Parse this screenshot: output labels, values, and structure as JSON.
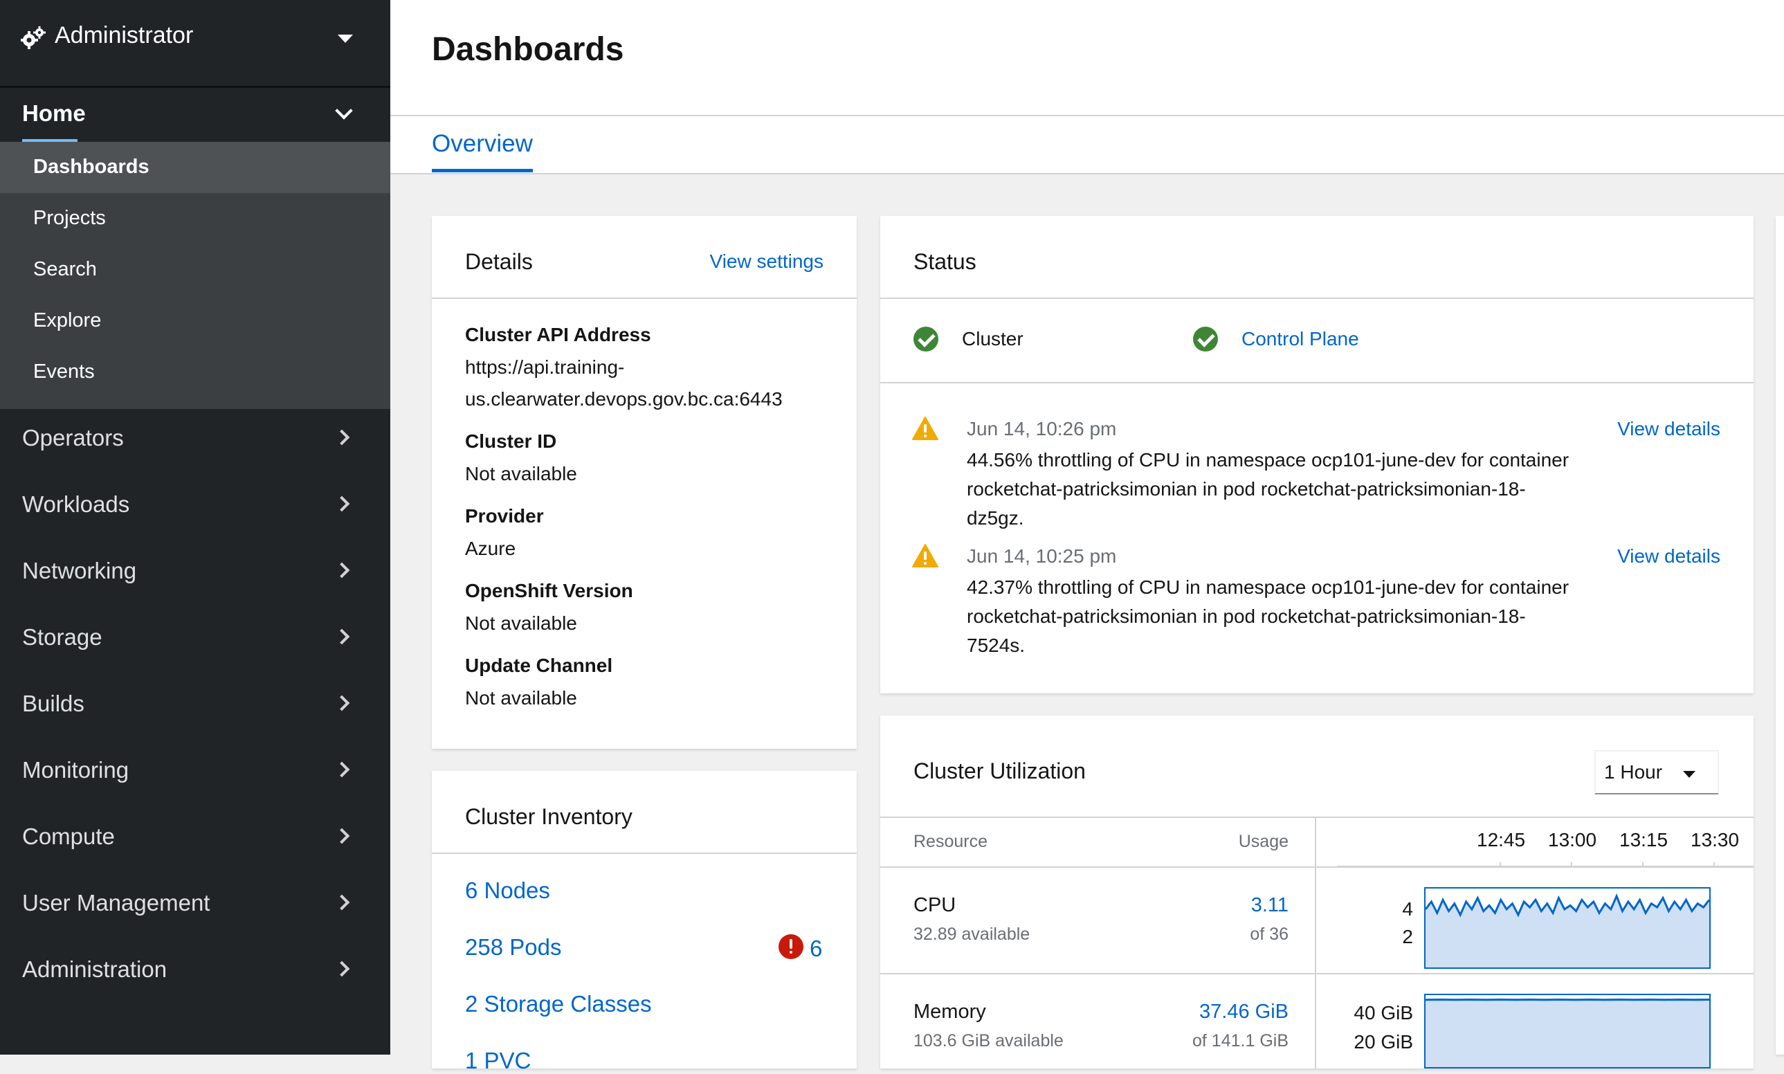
{
  "perspective": {
    "label": "Administrator",
    "icon": "gears-icon"
  },
  "nav": {
    "home": {
      "label": "Home",
      "items": [
        {
          "label": "Dashboards",
          "active": true
        },
        {
          "label": "Projects"
        },
        {
          "label": "Search"
        },
        {
          "label": "Explore"
        },
        {
          "label": "Events"
        }
      ]
    },
    "sections": [
      {
        "label": "Operators"
      },
      {
        "label": "Workloads"
      },
      {
        "label": "Networking"
      },
      {
        "label": "Storage"
      },
      {
        "label": "Builds"
      },
      {
        "label": "Monitoring"
      },
      {
        "label": "Compute"
      },
      {
        "label": "User Management"
      },
      {
        "label": "Administration"
      }
    ]
  },
  "page": {
    "title": "Dashboards",
    "tabs": [
      {
        "label": "Overview",
        "active": true
      }
    ]
  },
  "details": {
    "title": "Details",
    "settings_link": "View settings",
    "fields": [
      {
        "term": "Cluster API Address",
        "value_line1": "https://api.training-",
        "value_line2": "us.clearwater.devops.gov.bc.ca:6443"
      },
      {
        "term": "Cluster ID",
        "value": "Not available"
      },
      {
        "term": "Provider",
        "value": "Azure"
      },
      {
        "term": "OpenShift Version",
        "value": "Not available"
      },
      {
        "term": "Update Channel",
        "value": "Not available"
      }
    ]
  },
  "inventory": {
    "title": "Cluster Inventory",
    "items": [
      {
        "label": "6 Nodes"
      },
      {
        "label": "258 Pods",
        "error_count": "6"
      },
      {
        "label": "2 Storage Classes"
      },
      {
        "label": "1 PVC"
      }
    ]
  },
  "status": {
    "title": "Status",
    "health": [
      {
        "label": "Cluster",
        "state": "ok",
        "link": false
      },
      {
        "label": "Control Plane",
        "state": "ok",
        "link": true
      }
    ],
    "alerts": [
      {
        "time": "Jun 14, 10:26 pm",
        "line1": "44.56% throttling of CPU in namespace ocp101-june-dev for container",
        "line2": "rocketchat-patricksimonian in pod rocketchat-patricksimonian-18-",
        "line3": "dz5gz.",
        "link": "View details"
      },
      {
        "time": "Jun 14, 10:25 pm",
        "line1": "42.37% throttling of CPU in namespace ocp101-june-dev for container",
        "line2": "rocketchat-patricksimonian in pod rocketchat-patricksimonian-18-",
        "line3": "7524s.",
        "link": "View details"
      }
    ]
  },
  "utilization": {
    "title": "Cluster Utilization",
    "duration": "1 Hour",
    "col_resource": "Resource",
    "col_usage": "Usage",
    "time_ticks": [
      "12:45",
      "13:00",
      "13:15",
      "13:30"
    ],
    "rows": [
      {
        "name": "CPU",
        "available": "32.89 available",
        "usage": "3.11",
        "of": "of 36",
        "axis_labels": [
          "4",
          "2"
        ],
        "sparkline": [
          3.1,
          3.5,
          2.9,
          3.6,
          3.0,
          3.4,
          2.8,
          3.5,
          3.1,
          3.7,
          3.0,
          3.3,
          2.9,
          3.6,
          3.1,
          3.4,
          2.8,
          3.5,
          3.2,
          3.6,
          3.0,
          3.4,
          2.9,
          3.7,
          3.1,
          3.3,
          3.0,
          3.6,
          3.2,
          3.5,
          2.9,
          3.4,
          3.1,
          3.8,
          3.0,
          3.5,
          3.1,
          3.6,
          2.9,
          3.4,
          3.2,
          3.7,
          3.0,
          3.5,
          3.1,
          3.6,
          3.0,
          3.4,
          3.2,
          3.6
        ]
      },
      {
        "name": "Memory",
        "available": "103.6 GiB available",
        "usage": "37.46 GiB",
        "of": "of 141.1 GiB",
        "axis_labels": [
          "40 GiB",
          "20 GiB"
        ],
        "sparkline": [
          37.4,
          37.5,
          37.4,
          37.5,
          37.4,
          37.5,
          37.4,
          37.5,
          37.4,
          37.5,
          37.4,
          37.5,
          37.4,
          37.5,
          37.4,
          37.5,
          37.4,
          37.5,
          37.4,
          37.5
        ]
      }
    ]
  },
  "colors": {
    "link": "#0066cc",
    "ok": "#3e8635",
    "warning": "#f0ab00",
    "danger": "#c9190b",
    "sidebar": "#212427"
  }
}
